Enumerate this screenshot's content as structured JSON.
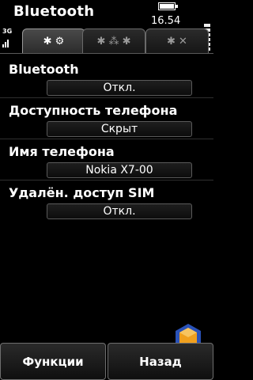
{
  "status": {
    "title": "Bluetooth",
    "time": "16.54",
    "network": "3G",
    "signal_icon": "signal-bars-icon",
    "battery_icon": "battery-icon"
  },
  "tabs": [
    {
      "label": "✱ ⚙",
      "icon": "bluetooth-settings-icon",
      "active": true
    },
    {
      "label": "✱ ⁂ ✱",
      "icon": "paired-devices-icon",
      "active": false
    },
    {
      "label": "✱ ✕",
      "icon": "blocked-devices-icon",
      "active": false
    }
  ],
  "settings": [
    {
      "label": "Bluetooth",
      "value": "Откл."
    },
    {
      "label": "Доступность телефона",
      "value": "Скрыт"
    },
    {
      "label": "Имя телефона",
      "value": "Nokia X7-00"
    },
    {
      "label": "Удалён. доступ SIM",
      "value": "Откл."
    }
  ],
  "softkeys": {
    "left": "Функции",
    "right": "Назад"
  },
  "colors": {
    "background": "#000000",
    "text": "#ffffff",
    "border": "#6a6a6a",
    "logo_orange": "#f0a01e",
    "logo_blue": "#2a52b8"
  }
}
